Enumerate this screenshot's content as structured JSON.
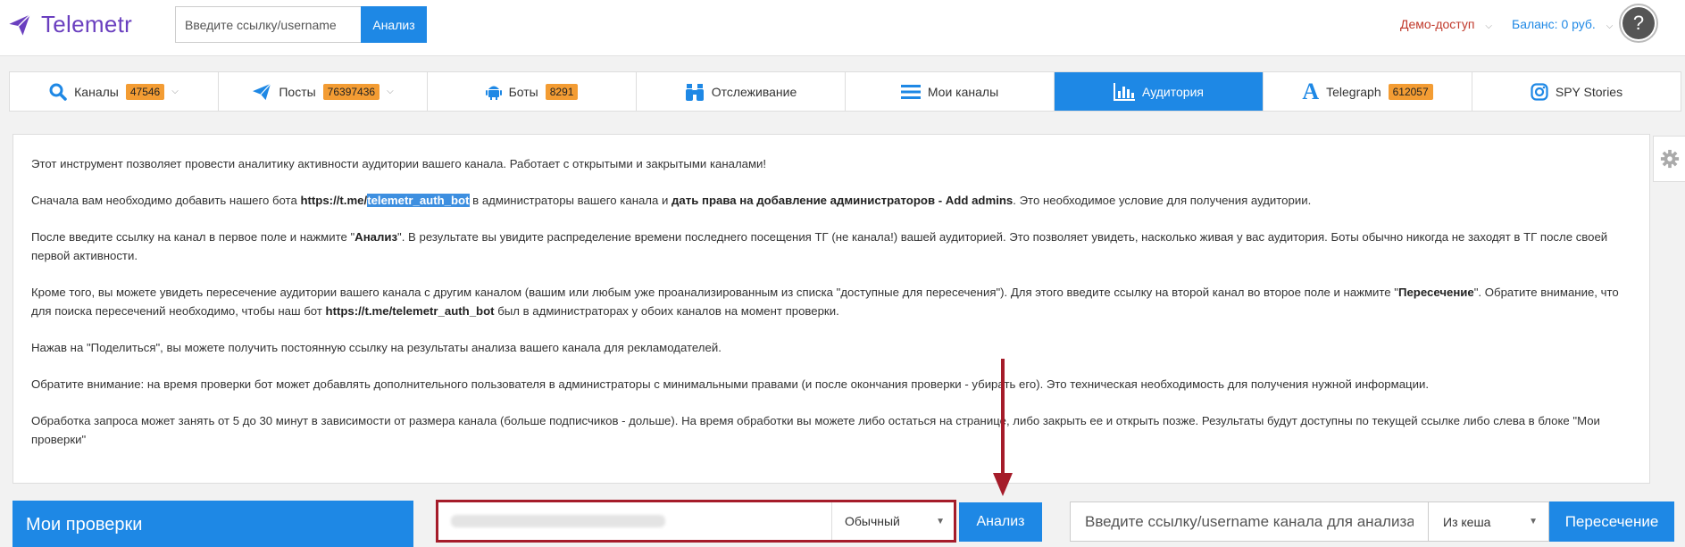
{
  "header": {
    "logo_text": "Telemetr",
    "search_placeholder": "Введите ссылку/username",
    "search_button": "Анализ",
    "demo_label": "Демо-доступ",
    "balance_label": "Баланс: 0 руб.",
    "avatar_text": "?"
  },
  "tabs": [
    {
      "label": "Каналы",
      "badge": "47546",
      "icon": "search-icon",
      "caret": true
    },
    {
      "label": "Посты",
      "badge": "76397436",
      "icon": "paper-plane-icon",
      "caret": true
    },
    {
      "label": "Боты",
      "badge": "8291",
      "icon": "android-icon"
    },
    {
      "label": "Отслеживание",
      "icon": "binoculars-icon"
    },
    {
      "label": "Мои каналы",
      "icon": "list-icon"
    },
    {
      "label": "Аудитория",
      "icon": "bar-chart-icon",
      "active": true
    },
    {
      "label": "Telegraph",
      "badge": "612057",
      "icon": "telegraph-icon"
    },
    {
      "label": "SPY Stories",
      "icon": "instagram-icon"
    }
  ],
  "info": {
    "p1": "Этот инструмент позволяет провести аналитику активности аудитории вашего канала. Работает с открытыми и закрытыми каналами!",
    "p2_a": "Сначала вам необходимо добавить нашего бота ",
    "p2_link_prefix": "https://t.me/",
    "p2_link_hl": "telemetr_auth_bot",
    "p2_b": " в администраторы вашего канала и ",
    "p2_bold": "дать права на добавление администраторов - Add admins",
    "p2_c": ". Это необходимое условие для получения аудитории.",
    "p3_a": "После введите ссылку на канал в первое поле и нажмите \"",
    "p3_bold": "Анализ",
    "p3_b": "\". В результате вы увидите распределение времени последнего посещения ТГ (не канала!) вашей аудиторией. Это позволяет увидеть, насколько живая у вас аудитория. Боты обычно никогда не заходят в ТГ после своей первой активности.",
    "p4_a": "Кроме того, вы можете увидеть пересечение аудитории вашего канала с другим каналом (вашим или любым уже проанализированным из списка \"доступные для пересечения\"). Для этого введите ссылку на второй канал во второе поле и нажмите \"",
    "p4_bold": "Пересечение",
    "p4_b": "\". Обратите внимание, что для поиска пересечений необходимо, чтобы наш бот ",
    "p4_link": "https://t.me/telemetr_auth_bot",
    "p4_c": " был в администраторах у обоих каналов на момент проверки.",
    "p5": "Нажав на \"Поделиться\", вы можете получить постоянную ссылку на результаты анализа вашего канала для рекламодателей.",
    "p6": "Обратите внимание: на время проверки бот может добавлять дополнительного пользователя в администраторы с минимальными правами (и после окончания проверки - убирать его). Это техническая необходимость для получения нужной информации.",
    "p7": "Обработка запроса может занять от 5 до 30 минут в зависимости от размера канала (больше подписчиков - дольше). На время обработки вы можете либо остаться на странице, либо закрыть ее и открыть позже. Результаты будут доступны по текущей ссылке либо слева в блоке \"Мои проверки\""
  },
  "bottom": {
    "my_checks": "Мои проверки",
    "mode_select": "Обычный",
    "analyze_button": "Анализ",
    "compare_placeholder": "Введите ссылку/username канала для анализа",
    "cache_select": "Из кеша",
    "cross_button": "Пересечение"
  },
  "colors": {
    "brand": "#6a3fbf",
    "accent": "#1e88e5",
    "badge": "#f39c33",
    "annotation": "#a51c2a"
  }
}
